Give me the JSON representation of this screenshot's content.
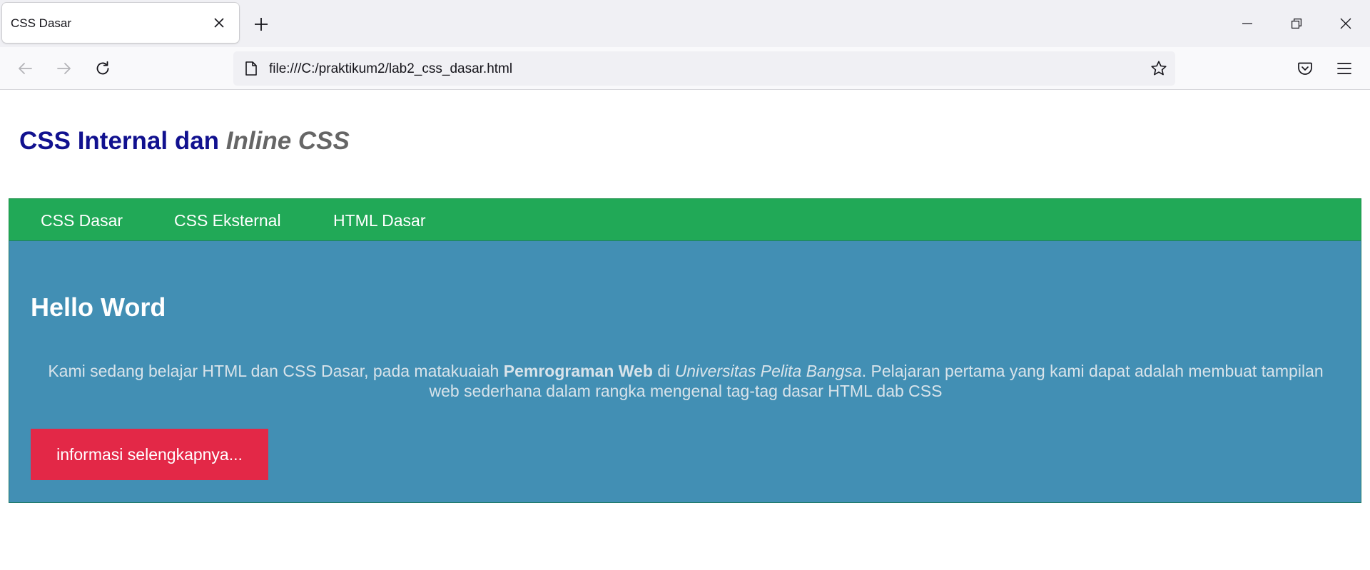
{
  "browser": {
    "tab_title": "CSS Dasar",
    "url": "file:///C:/praktikum2/lab2_css_dasar.html",
    "icons": {
      "tab_close": "close-icon",
      "new_tab": "plus-icon",
      "minimize": "minimize-icon",
      "restore": "restore-icon",
      "close_window": "close-icon",
      "back": "back-arrow-icon",
      "forward": "forward-arrow-icon",
      "reload": "reload-icon",
      "page": "page-icon",
      "bookmark": "star-icon",
      "pocket": "pocket-icon",
      "menu": "hamburger-menu-icon"
    }
  },
  "page": {
    "header": {
      "text_plain": "CSS Internal dan ",
      "text_emphasis": "Inline CSS"
    },
    "nav": {
      "items": [
        "CSS Dasar",
        "CSS Eksternal",
        "HTML Dasar"
      ]
    },
    "hero": {
      "title": "Hello Word",
      "paragraph": {
        "part1": "Kami sedang belajar HTML dan CSS Dasar, pada matakuaiah ",
        "bold": "Pemrograman Web",
        "part2": " di ",
        "italic": "Universitas Pelita Bangsa",
        "part3": ". Pelajaran pertama yang kami dapat adalah membuat tampilan web sederhana dalam rangka mengenal tag-tag dasar HTML dab CSS"
      },
      "button_label": "informasi selengkapnya..."
    }
  },
  "colors": {
    "header_text": "#11118f",
    "header_emphasis": "#666666",
    "nav_background": "#21a957",
    "hero_background": "#428fb4",
    "hero_text": "#d8e3ea",
    "button_background": "#e32847"
  }
}
